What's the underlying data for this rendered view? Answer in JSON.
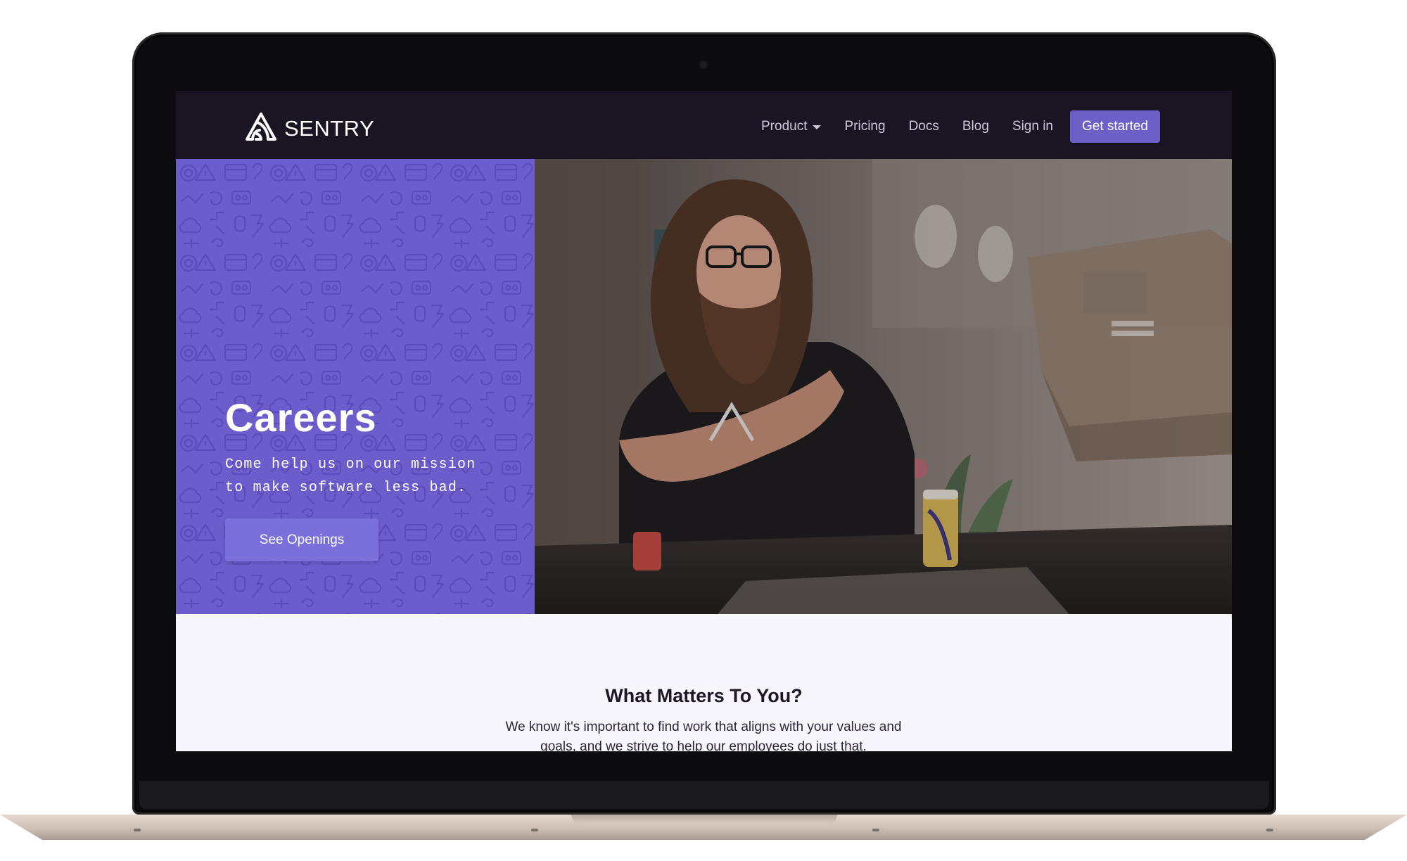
{
  "brand": {
    "name": "SENTRY"
  },
  "nav": {
    "items": [
      {
        "label": "Product",
        "has_dropdown": true
      },
      {
        "label": "Pricing"
      },
      {
        "label": "Docs"
      },
      {
        "label": "Blog"
      },
      {
        "label": "Sign in"
      }
    ],
    "cta_label": "Get started"
  },
  "hero": {
    "title": "Careers",
    "subtitle": "Come help us on our mission\nto make software less bad.",
    "button_label": "See Openings"
  },
  "section": {
    "title": "What Matters To You?",
    "text": "We know it's important to find work that aligns with your values and goals, and we strive to help our employees do just that."
  },
  "colors": {
    "navbar_bg": "#1a1423",
    "accent": "#6c5fc7",
    "hero_purple": "#6c5dcd",
    "page_bg": "#f7f6fc"
  },
  "icons": [
    "sentry-logo-icon",
    "chevron-down-icon"
  ]
}
